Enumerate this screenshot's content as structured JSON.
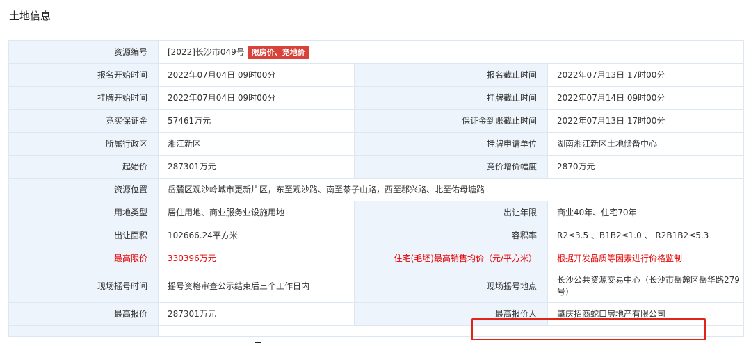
{
  "page": {
    "title": "土地信息"
  },
  "resource": {
    "label": "资源编号",
    "value": "[2022]长沙市049号",
    "tag": "限房价、竞地价"
  },
  "rows": [
    {
      "l1": "报名开始时间",
      "v1": "2022年07月04日 09时00分",
      "l2": "报名截止时间",
      "v2": "2022年07月13日 17时00分"
    },
    {
      "l1": "挂牌开始时间",
      "v1": "2022年07月04日 09时00分",
      "l2": "挂牌截止时间",
      "v2": "2022年07月14日 09时00分"
    },
    {
      "l1": "竞买保证金",
      "v1": "57461万元",
      "l2": "保证金到账截止时间",
      "v2": "2022年07月13日 17时00分"
    },
    {
      "l1": "所属行政区",
      "v1": "湘江新区",
      "l2": "挂牌申请单位",
      "v2": "湖南湘江新区土地储备中心"
    },
    {
      "l1": "起始价",
      "v1": "287301万元",
      "l2": "竞价增价幅度",
      "v2": "2870万元"
    }
  ],
  "location": {
    "label": "资源位置",
    "value": "岳麓区观沙岭城市更新片区，东至观沙路、南至茶子山路，西至郡兴路、北至佑母塘路"
  },
  "rows2": [
    {
      "l1": "用地类型",
      "v1": "居住用地、商业服务业设施用地",
      "l2": "出让年限",
      "v2": "商业40年、住宅70年"
    },
    {
      "l1": "出让面积",
      "v1": "102666.24平方米",
      "l2": "容积率",
      "v2": "R2≤3.5 、B1B2≤1.0 、 R2B1B2≤5.3"
    }
  ],
  "price_limit": {
    "l1": "最高限价",
    "v1": "330396万元",
    "l2": "住宅(毛坯)最高销售均价（元/平方米）",
    "v2": "根据开发品质等因素进行价格监制"
  },
  "lottery": {
    "l1": "现场摇号时间",
    "v1": "摇号资格审查公示结束后三个工作日内",
    "l2": "现场摇号地点",
    "v2": "长沙公共资源交易中心（长沙市岳麓区岳华路279号）"
  },
  "top_bid": {
    "l1": "最高报价",
    "v1": "287301万元",
    "l2": "最高报价人",
    "v2": "肇庆招商蛇口房地产有限公司"
  },
  "colors": {
    "label_bg": "#eef4fb",
    "border": "#dde7f1",
    "red_text": "#e60000",
    "tag_bg": "#d9423a",
    "highlight": "#e2231a"
  }
}
